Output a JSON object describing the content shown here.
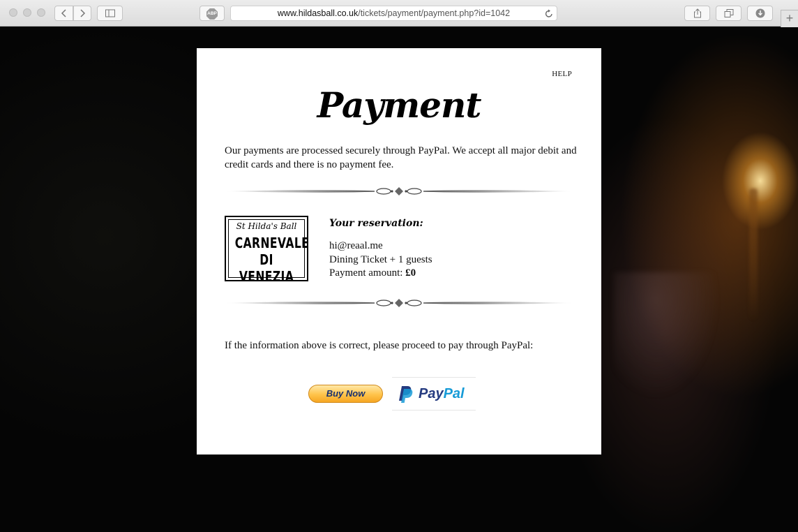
{
  "browser": {
    "url_host": "www.hildasball.co.uk",
    "url_path": "/tickets/payment/payment.php?id=1042",
    "adblock_label": "ABP",
    "new_tab_label": "+"
  },
  "page": {
    "help_label": "HELP",
    "title": "Payment",
    "intro": "Our payments are processed securely through PayPal. We accept all major debit and credit cards and there is no payment fee.",
    "logo": {
      "script_text": "St Hilda's Ball",
      "line1": "CARNEVALE",
      "line2": "DI VENEZIA"
    },
    "reservation": {
      "heading": "Your reservation:",
      "email": "hi@reaal.me",
      "ticket": "Dining Ticket + 1 guests",
      "amount_label": "Payment amount:",
      "amount_value": "£0"
    },
    "proceed_text": "If the information above is correct, please proceed to pay through PayPal:",
    "buy_now_label": "Buy Now",
    "paypal_pay": "Pay",
    "paypal_pal": "Pal"
  },
  "colors": {
    "paypal_dark": "#253b80",
    "paypal_light": "#179bd7",
    "button_gold": "#ffc34a"
  }
}
